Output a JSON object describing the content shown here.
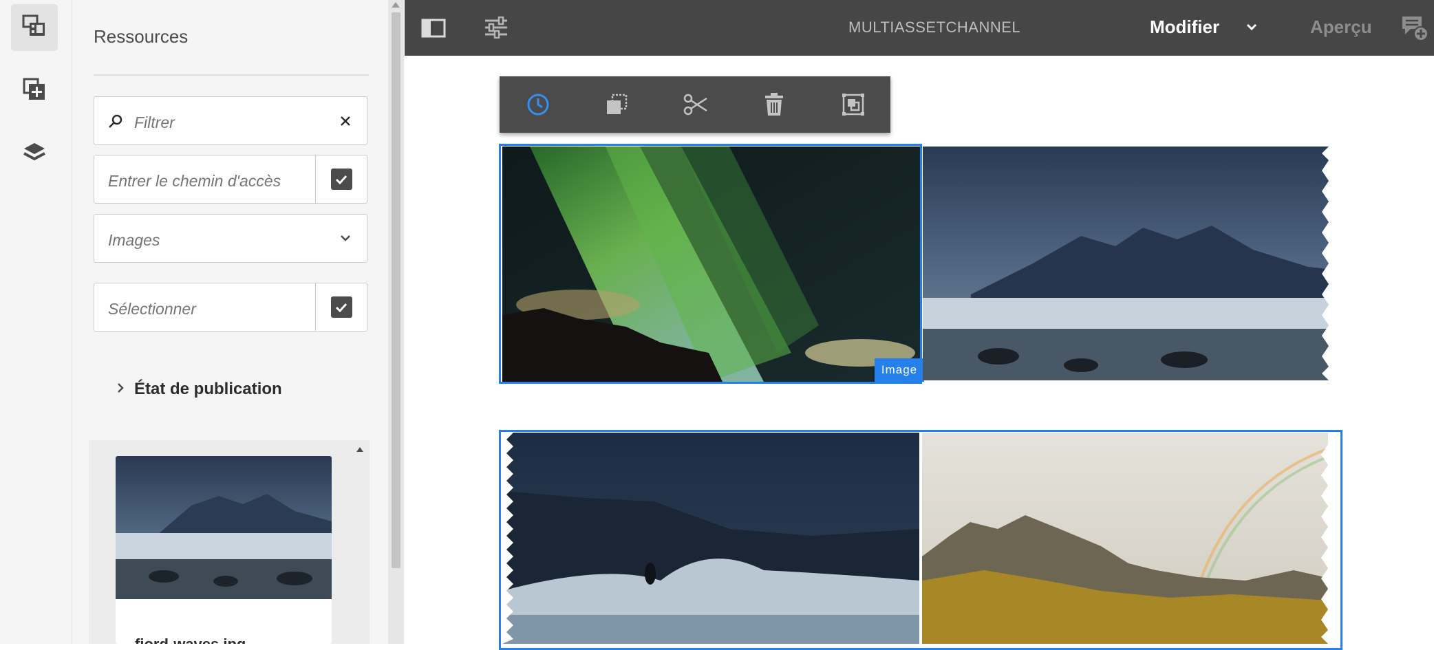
{
  "rail": {
    "items": [
      {
        "icon": "assets-icon",
        "active": true
      },
      {
        "icon": "components-icon",
        "active": false
      },
      {
        "icon": "layers-icon",
        "active": false
      }
    ]
  },
  "panel": {
    "title": "Ressources",
    "filter": {
      "placeholder": "Filtrer"
    },
    "path": {
      "placeholder": "Entrer le chemin d'accès"
    },
    "type_select": {
      "value": "Images"
    },
    "select_field": {
      "placeholder": "Sélectionner"
    },
    "publication_status": "État de publication",
    "card": {
      "name": "fjord-waves.jpg"
    }
  },
  "topbar": {
    "channel_title": "MULTIASSETCHANNEL",
    "mode": "Modifier",
    "preview": "Aperçu"
  },
  "editor": {
    "toolbar": [
      "history-icon",
      "copy-icon",
      "cut-icon",
      "delete-icon",
      "group-icon"
    ],
    "image_badge": "Image"
  },
  "colors": {
    "accent": "#2680eb",
    "topbar": "#464646",
    "panel": "#f5f5f5"
  }
}
